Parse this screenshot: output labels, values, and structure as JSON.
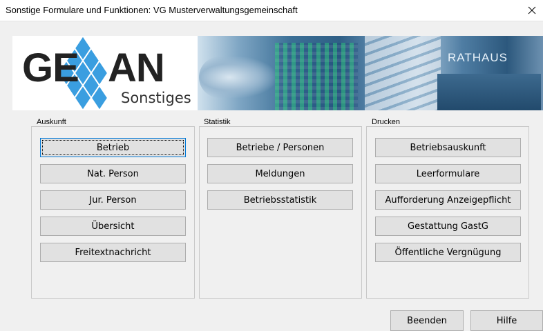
{
  "window": {
    "title": "Sonstige Formulare und Funktionen: VG Musterverwaltungsgemeinschaft"
  },
  "banner": {
    "logo_text": "GEWAN",
    "logo_subtitle": "Sonstiges",
    "photo_label": "RATHAUS"
  },
  "groups": {
    "auskunft": {
      "label": "Auskunft",
      "buttons": [
        "Betrieb",
        "Nat. Person",
        "Jur. Person",
        "Übersicht",
        "Freitextnachricht"
      ]
    },
    "statistik": {
      "label": "Statistik",
      "buttons": [
        "Betriebe / Personen",
        "Meldungen",
        "Betriebsstatistik"
      ]
    },
    "drucken": {
      "label": "Drucken",
      "buttons": [
        "Betriebsauskunft",
        "Leerformulare",
        "Aufforderung Anzeigepflicht",
        "Gestattung GastG",
        "Öffentliche Vergnügung"
      ]
    }
  },
  "footer": {
    "beenden": "Beenden",
    "hilfe": "Hilfe"
  },
  "icons": {
    "close": "close-icon"
  },
  "colors": {
    "focus_border": "#0078d7",
    "button_face": "#e1e1e1",
    "logo_diamond": "#3a9ee0"
  }
}
